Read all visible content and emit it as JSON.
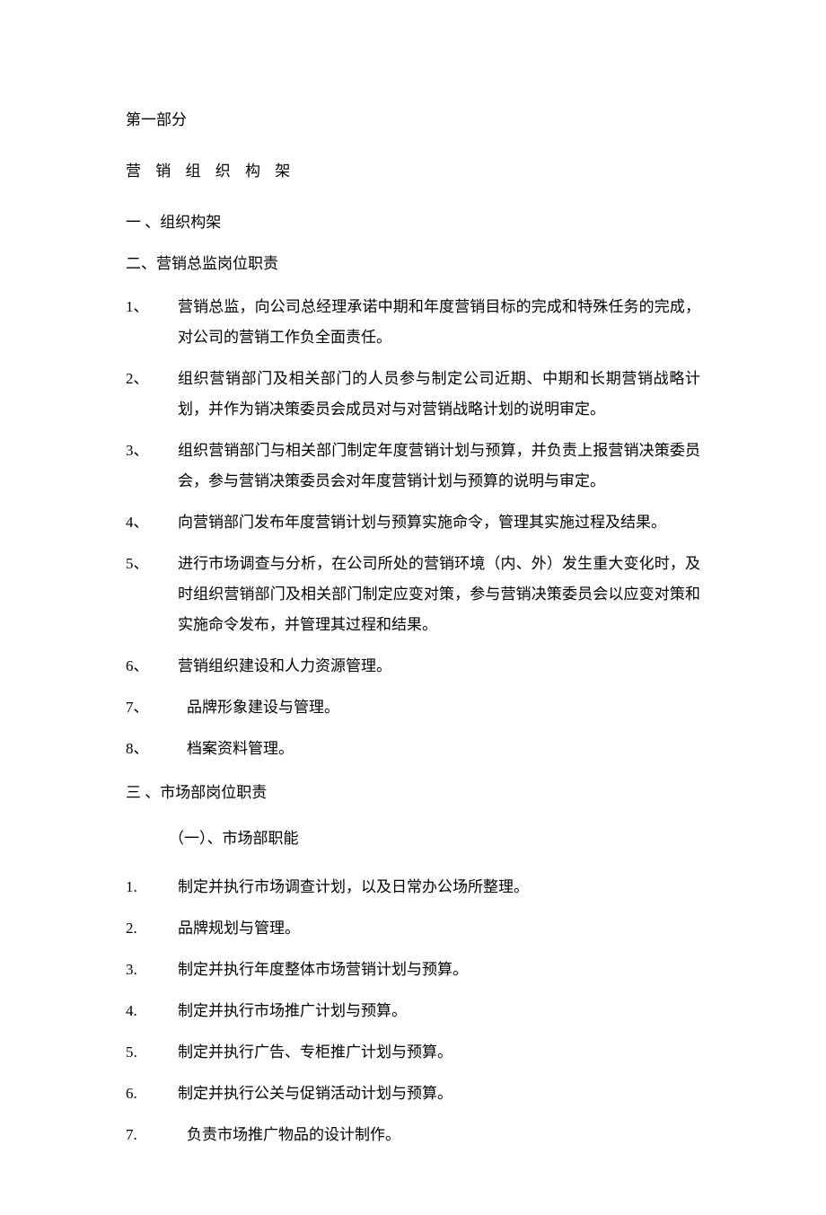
{
  "part_title": "第一部分",
  "subtitle": "营 销 组 织 构 架",
  "section1": {
    "heading": "一 、组织构架"
  },
  "section2": {
    "heading": "二、营销总监岗位职责",
    "items": [
      {
        "num": "1、",
        "text": "营销总监，向公司总经理承诺中期和年度营销目标的完成和特殊任务的完成，对公司的营销工作负全面责任。"
      },
      {
        "num": "2、",
        "text": "组织营销部门及相关部门的人员参与制定公司近期、中期和长期营销战略计划，并作为销决策委员会成员对与对营销战略计划的说明审定。"
      },
      {
        "num": "3、",
        "text": "组织营销部门与相关部门制定年度营销计划与预算，并负责上报营销决策委员会，参与营销决策委员会对年度营销计划与预算的说明与审定。"
      },
      {
        "num": "4、",
        "text": "向营销部门发布年度营销计划与预算实施命令，管理其实施过程及结果。"
      },
      {
        "num": "5、",
        "text": "进行市场调查与分析，在公司所处的营销环境（内、外）发生重大变化时，及时组织营销部门及相关部门制定应变对策，参与营销决策委员会以应变对策和实施命令发布，并管理其过程和结果。"
      },
      {
        "num": "6、",
        "text": "营销组织建设和人力资源管理。"
      },
      {
        "num": "7、",
        "text": "品牌形象建设与管理。"
      },
      {
        "num": "8、",
        "text": "档案资料管理。"
      }
    ]
  },
  "section3": {
    "heading": "三 、市场部岗位职责",
    "subsection1": {
      "heading": "（一）、市场部职能",
      "items": [
        {
          "num": "1.",
          "text": "制定并执行市场调查计划，以及日常办公场所整理。"
        },
        {
          "num": "2.",
          "text": "品牌规划与管理。"
        },
        {
          "num": "3.",
          "text": "制定并执行年度整体市场营销计划与预算。"
        },
        {
          "num": "4.",
          "text": "制定并执行市场推广计划与预算。"
        },
        {
          "num": "5.",
          "text": "制定并执行广告、专柜推广计划与预算。"
        },
        {
          "num": "6.",
          "text": "制定并执行公关与促销活动计划与预算。"
        },
        {
          "num": "7.",
          "text": "负责市场推广物品的设计制作。"
        }
      ]
    }
  }
}
